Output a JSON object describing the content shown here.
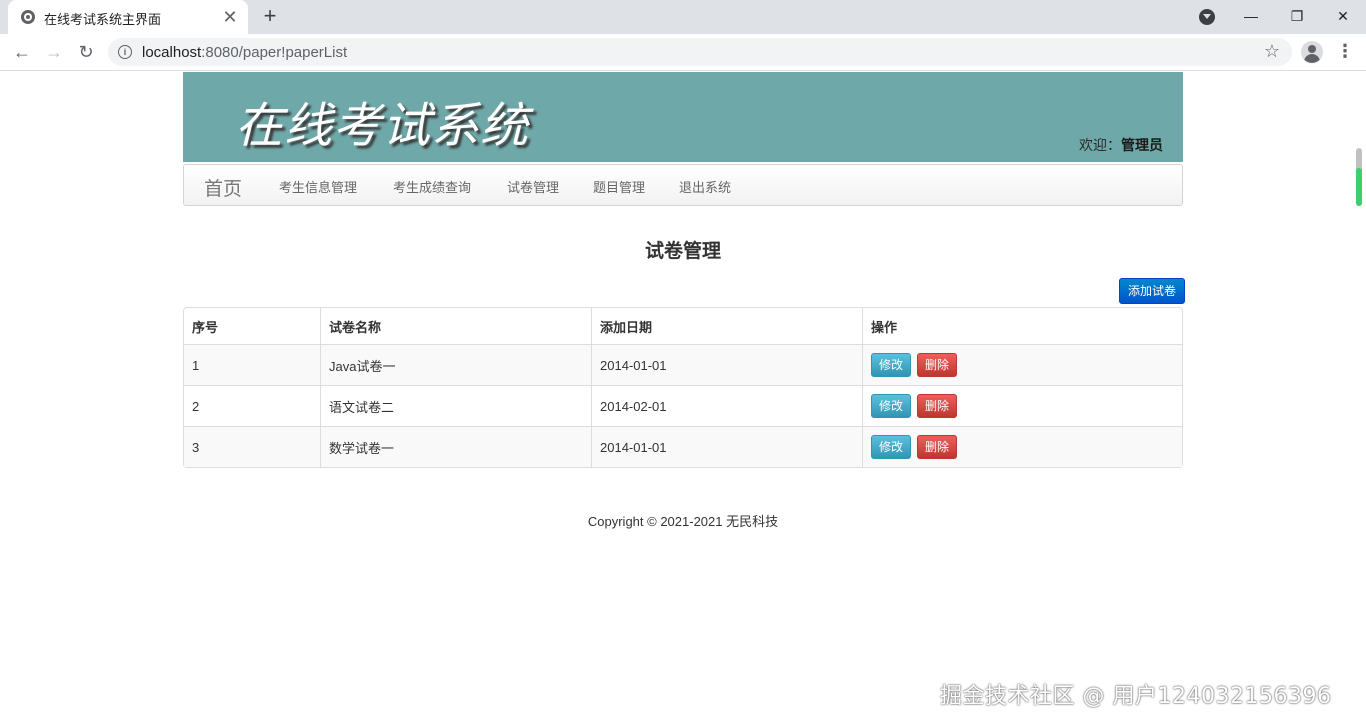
{
  "browser": {
    "tab_title": "在线考试系统主界面",
    "url_host": "localhost",
    "url_rest": ":8080/paper!paperList"
  },
  "banner": {
    "title": "在线考试系统",
    "welcome_prefix": "欢迎：",
    "welcome_user": "管理员",
    "bg_color": "#6fa8a8"
  },
  "nav": {
    "brand": "首页",
    "items": [
      "考生信息管理",
      "考生成绩查询",
      "试卷管理",
      "题目管理",
      "退出系统"
    ]
  },
  "main": {
    "heading": "试卷管理",
    "add_button": "添加试卷",
    "table": {
      "headers": [
        "序号",
        "试卷名称",
        "添加日期",
        "操作"
      ],
      "rows": [
        {
          "index": "1",
          "name": "Java试卷一",
          "date": "2014-01-01"
        },
        {
          "index": "2",
          "name": "语文试卷二",
          "date": "2014-02-01"
        },
        {
          "index": "3",
          "name": "数学试卷一",
          "date": "2014-01-01"
        }
      ],
      "edit_label": "修改",
      "delete_label": "删除"
    }
  },
  "footer": {
    "copyright": "Copyright © 2021-2021 无民科技"
  },
  "watermark": "掘金技术社区 @ 用户124032156396",
  "icons": {
    "favicon": "globe-icon",
    "close": "close-icon",
    "new_tab": "plus-icon",
    "back": "back-arrow-icon",
    "forward": "forward-arrow-icon",
    "reload": "reload-icon",
    "site_info": "info-icon",
    "bookmark": "star-icon",
    "account": "account-icon",
    "menu": "kebab-menu-icon"
  }
}
